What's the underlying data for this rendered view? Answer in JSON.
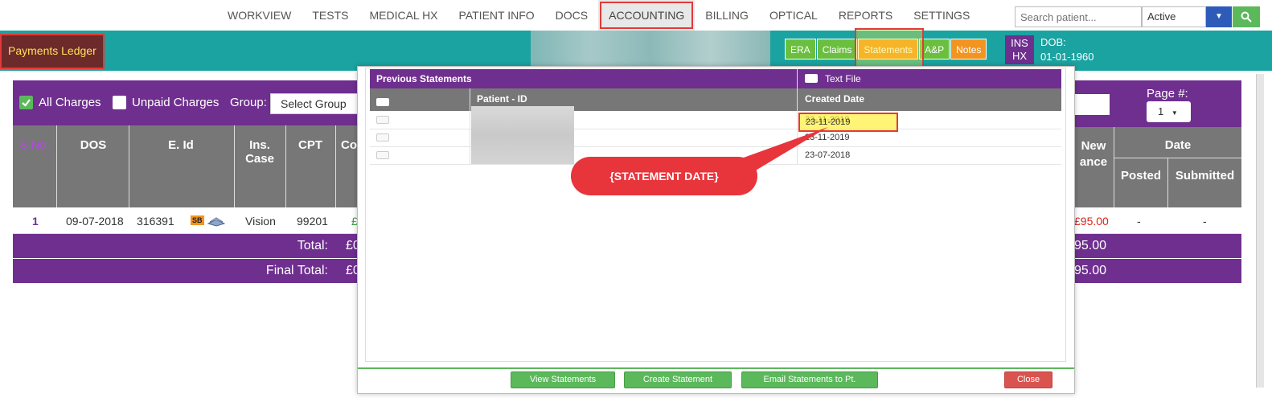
{
  "nav": {
    "items": [
      "WORKVIEW",
      "TESTS",
      "MEDICAL HX",
      "PATIENT INFO",
      "DOCS",
      "ACCOUNTING",
      "BILLING",
      "OPTICAL",
      "REPORTS",
      "SETTINGS"
    ],
    "active": "ACCOUNTING",
    "search_placeholder": "Search patient...",
    "status": "Active"
  },
  "header": {
    "ledger_title": "Payments Ledger",
    "tabs": [
      "ERA",
      "Claims",
      "Statements",
      "A&P",
      "Notes"
    ],
    "ins": "INS",
    "hx": "HX",
    "dob_label": "DOB:",
    "dob_value": "01-01-1960"
  },
  "ledger": {
    "all_charges": "All Charges",
    "unpaid_charges": "Unpaid Charges",
    "group_label": "Group:",
    "group_value": "Select Group",
    "page_label": "Page #:",
    "page_value": "1",
    "columns": {
      "sno": "S.No.",
      "dos": "DOS",
      "eid": "E. Id",
      "ins1": "Ins.",
      "ins2": "Case",
      "cpt": "CPT",
      "co": "Co",
      "new1": "New",
      "new2": "ance",
      "date": "Date",
      "posted": "Posted",
      "submitted": "Submitted"
    },
    "row": {
      "sno": "1",
      "dos": "09-07-2018",
      "eid": "316391",
      "sb": "SB",
      "ins": "Vision",
      "cpt": "99201",
      "pound": "£",
      "balance": "£95.00",
      "posted": "-",
      "submitted": "-"
    },
    "total_label": "Total:",
    "total_prefix": "£0",
    "total_right": "95.00",
    "final_total_label": "Final Total:",
    "final_prefix": "£0",
    "final_right": "95.00"
  },
  "modal": {
    "title": "Previous Statements",
    "text_file": "Text File",
    "col_patient": "Patient - ID",
    "col_created": "Created Date",
    "rows": [
      {
        "date": "23-11-2019"
      },
      {
        "date": "23-11-2019"
      },
      {
        "date": "23-07-2018"
      }
    ],
    "callout": "{STATEMENT DATE}",
    "buttons": {
      "view": "View Statements",
      "create": "Create Statement",
      "email": "Email Statements to Pt.",
      "close": "Close"
    }
  },
  "colors": {
    "teal": "#1aa3a0",
    "purple": "#6f2f8f",
    "green": "#5bb85b",
    "orange": "#f29420",
    "red": "#e03a3a"
  }
}
